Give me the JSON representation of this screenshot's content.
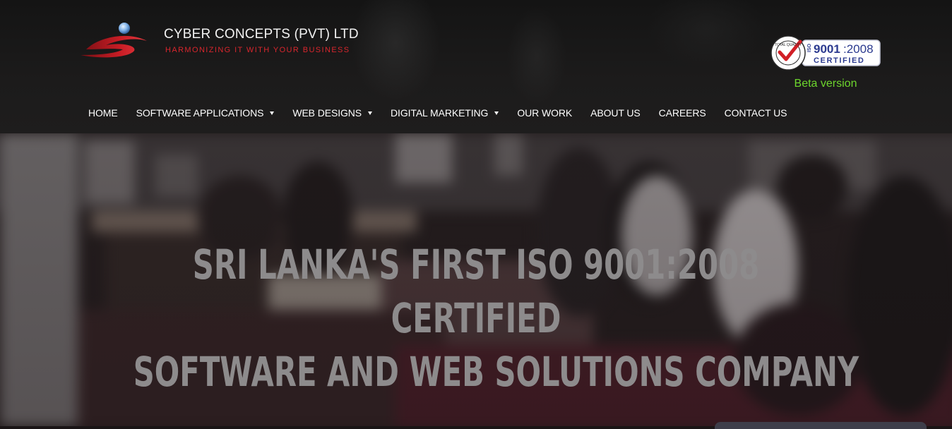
{
  "brand": {
    "name": "CYBER CONCEPTS (PVT) LTD",
    "tagline": "HARMONIZING IT WITH YOUR BUSINESS"
  },
  "iso_badge": {
    "seal_text": "TOTAL QUALITY",
    "iso_label": "ISO",
    "standard": "9001",
    "year": ":2008",
    "certified": "CERTIFIED"
  },
  "beta_label": "Beta version",
  "nav": {
    "items": [
      {
        "label": "HOME",
        "has_dropdown": false
      },
      {
        "label": "SOFTWARE APPLICATIONS",
        "has_dropdown": true
      },
      {
        "label": "WEB DESIGNS",
        "has_dropdown": true
      },
      {
        "label": "DIGITAL MARKETING",
        "has_dropdown": true
      },
      {
        "label": "OUR WORK",
        "has_dropdown": false
      },
      {
        "label": "ABOUT US",
        "has_dropdown": false
      },
      {
        "label": "CAREERS",
        "has_dropdown": false
      },
      {
        "label": "CONTACT US",
        "has_dropdown": false
      }
    ]
  },
  "hero": {
    "line1": "SRI LANKA'S FIRST ISO 9001:2008",
    "line2": "CERTIFIED",
    "line3": "SOFTWARE AND WEB SOLUTIONS COMPANY"
  },
  "colors": {
    "accent_red": "#d8262d",
    "beta_green": "#6dd62d",
    "hero_text": "#8d8b8c",
    "header_bg": "#1a1a1a"
  }
}
